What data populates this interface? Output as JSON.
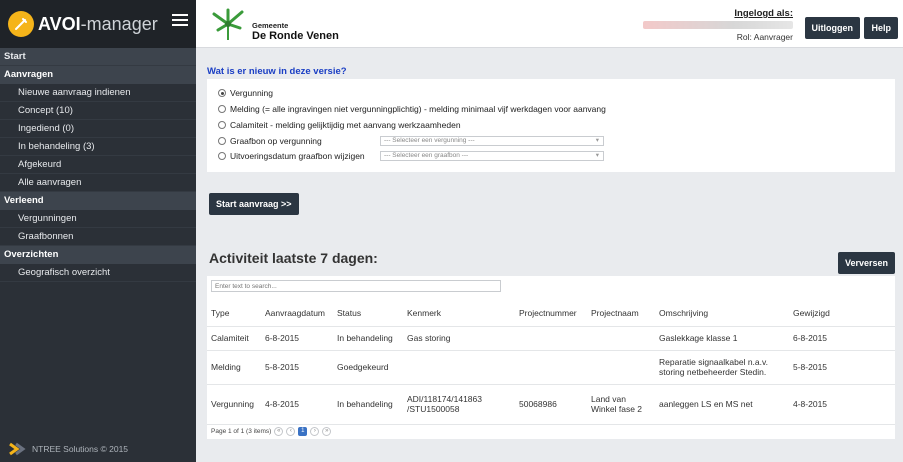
{
  "brand": {
    "name": "AVOI",
    "suffix": "-manager"
  },
  "sidebar": {
    "items": [
      {
        "label": "Start",
        "kind": "first"
      },
      {
        "label": "Aanvragen",
        "kind": "section"
      },
      {
        "label": "Nieuwe aanvraag indienen",
        "kind": "item"
      },
      {
        "label": "Concept (10)",
        "kind": "item"
      },
      {
        "label": "Ingediend (0)",
        "kind": "item"
      },
      {
        "label": "In behandeling (3)",
        "kind": "item"
      },
      {
        "label": "Afgekeurd",
        "kind": "item"
      },
      {
        "label": "Alle aanvragen",
        "kind": "item"
      },
      {
        "label": "Verleend",
        "kind": "section"
      },
      {
        "label": "Vergunningen",
        "kind": "item"
      },
      {
        "label": "Graafbonnen",
        "kind": "item"
      },
      {
        "label": "Overzichten",
        "kind": "section"
      },
      {
        "label": "Geografisch overzicht",
        "kind": "item"
      }
    ],
    "footer": "NTREE Solutions © 2015"
  },
  "header": {
    "municipality_small": "Gemeente",
    "municipality_big": "De Ronde Venen",
    "login_label": "Ingelogd als:",
    "role": "Rol: Aanvrager",
    "logout_label": "Uitloggen",
    "help_label": "Help"
  },
  "main": {
    "news_link": "Wat is er nieuw in deze versie?",
    "options": [
      {
        "label": "Vergunning",
        "checked": true
      },
      {
        "label": "Melding (= alle ingravingen niet vergunningplichtig) - melding minimaal vijf werkdagen voor aanvang",
        "checked": false
      },
      {
        "label": "Calamiteit - melding gelijktijdig met aanvang werkzaamheden",
        "checked": false
      },
      {
        "label": "Graafbon op vergunning",
        "checked": false
      },
      {
        "label": "Uitvoeringsdatum graafbon wijzigen",
        "checked": false
      }
    ],
    "select_vergunning": "--- Selecteer een vergunning ---",
    "select_graafbon": "--- Selecteer een graafbon ---",
    "start_button": "Start aanvraag >>",
    "activity_title": "Activiteit laatste 7 dagen:",
    "refresh_button": "Verversen",
    "filter_placeholder": "Enter text to search...",
    "table": {
      "headers": [
        "Type",
        "Aanvraagdatum",
        "Status",
        "Kenmerk",
        "Projectnummer",
        "Projectnaam",
        "Omschrijving",
        "Gewijzigd"
      ],
      "rows": [
        [
          "Calamiteit",
          "6-8-2015",
          "In behandeling",
          "Gas storing",
          "",
          "",
          "Gaslekkage klasse 1",
          "6-8-2015"
        ],
        [
          "Melding",
          "5-8-2015",
          "Goedgekeurd",
          "",
          "",
          "",
          "Reparatie signaalkabel n.a.v. storing netbeheerder Stedin.",
          "5-8-2015"
        ],
        [
          "Vergunning",
          "4-8-2015",
          "In behandeling",
          "ADI/118174/141863 /STU1500058",
          "50068986",
          "Land van Winkel fase 2",
          "aanleggen LS en MS net",
          "4-8-2015"
        ]
      ]
    },
    "pager_text": "Page 1 of 1 (3 items)",
    "pager_current": "1"
  }
}
